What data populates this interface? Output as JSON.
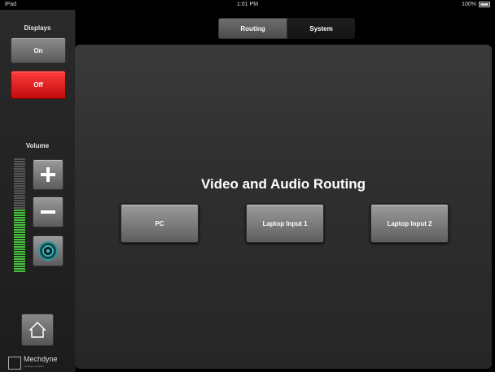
{
  "status_bar": {
    "carrier": "iPad",
    "time": "1:01 PM",
    "battery": "100%"
  },
  "sidebar": {
    "displays_label": "Displays",
    "on_label": "On",
    "off_label": "Off",
    "volume_label": "Volume",
    "volume_level": 0.55,
    "brand_name": "Mechdyne",
    "brand_tagline": "creating innovation"
  },
  "tabs": [
    {
      "label": "Routing",
      "active": true
    },
    {
      "label": "System",
      "active": false
    }
  ],
  "main": {
    "title": "Video and Audio Routing",
    "sources": [
      {
        "label": "PC"
      },
      {
        "label": "Laptop Input 1"
      },
      {
        "label": "Laptop Input 2"
      }
    ]
  },
  "colors": {
    "off_red": "#e01a1a",
    "meter_green": "#47c23d"
  }
}
